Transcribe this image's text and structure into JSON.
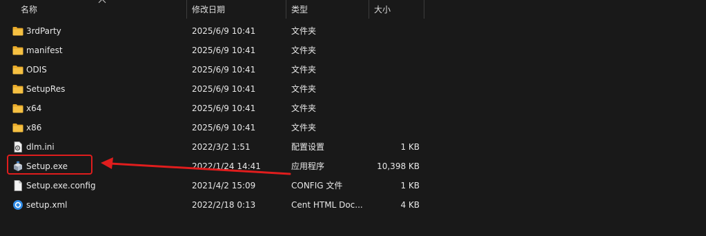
{
  "columns": {
    "name": "名称",
    "date": "修改日期",
    "type": "类型",
    "size": "大小"
  },
  "files": [
    {
      "name": "3rdParty",
      "date": "2025/6/9 10:41",
      "type": "文件夹",
      "size": "",
      "icon": "folder-icon"
    },
    {
      "name": "manifest",
      "date": "2025/6/9 10:41",
      "type": "文件夹",
      "size": "",
      "icon": "folder-icon"
    },
    {
      "name": "ODIS",
      "date": "2025/6/9 10:41",
      "type": "文件夹",
      "size": "",
      "icon": "folder-icon"
    },
    {
      "name": "SetupRes",
      "date": "2025/6/9 10:41",
      "type": "文件夹",
      "size": "",
      "icon": "folder-icon"
    },
    {
      "name": "x64",
      "date": "2025/6/9 10:41",
      "type": "文件夹",
      "size": "",
      "icon": "folder-icon"
    },
    {
      "name": "x86",
      "date": "2025/6/9 10:41",
      "type": "文件夹",
      "size": "",
      "icon": "folder-icon"
    },
    {
      "name": "dlm.ini",
      "date": "2022/3/2 1:51",
      "type": "配置设置",
      "size": "1 KB",
      "icon": "settings-file-icon"
    },
    {
      "name": "Setup.exe",
      "date": "2022/1/24 14:41",
      "type": "应用程序",
      "size": "10,398 KB",
      "icon": "installer-icon"
    },
    {
      "name": "Setup.exe.config",
      "date": "2021/4/2 15:09",
      "type": "CONFIG 文件",
      "size": "1 KB",
      "icon": "file-icon"
    },
    {
      "name": "setup.xml",
      "date": "2022/2/18 0:13",
      "type": "Cent HTML Doc...",
      "size": "4 KB",
      "icon": "browser-document-icon"
    }
  ],
  "colors": {
    "background": "#191919",
    "folder": "#f5c042",
    "annotation": "#e01d1d"
  }
}
